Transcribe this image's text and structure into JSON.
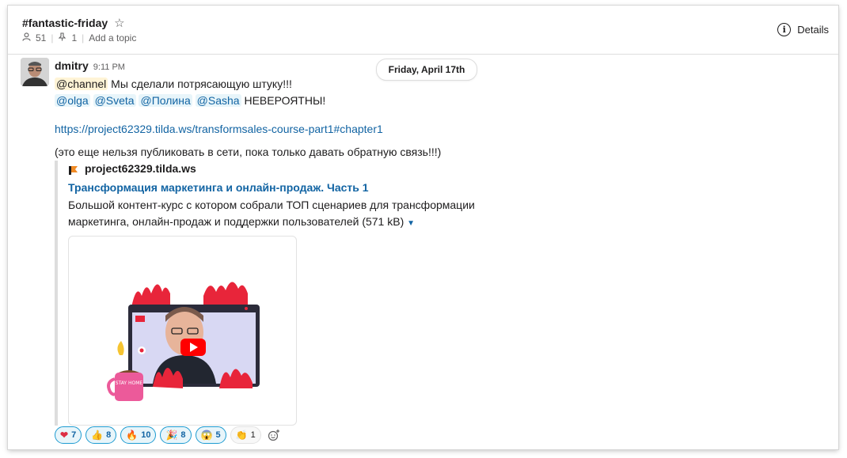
{
  "channel": {
    "name": "#fantastic-friday",
    "members": "51",
    "pinned": "1",
    "topic_placeholder": "Add a topic",
    "details_label": "Details"
  },
  "date_divider": "Friday, April 17th",
  "message": {
    "author": "dmitry",
    "time": "9:11 PM",
    "channel_mention": "@channel",
    "line1_text": " Мы сделали потрясающую штуку!!!",
    "mentions": [
      "@olga",
      "@Sveta",
      "@Полина",
      "@Sasha"
    ],
    "line2_text": " НЕВЕРОЯТНЫ!",
    "url": "https://project62329.tilda.ws/transformsales-course-part1#chapter1",
    "note": "(это еще нельзя публиковать в сети, пока только давать обратную связь!!!)"
  },
  "unfurl": {
    "site": "project62329.tilda.ws",
    "title": "Трансформация маркетинга и онлайн-продаж. Часть 1",
    "desc_line1": "Большой контент-курс с котором собрали ТОП сценариев для трансформации",
    "desc_line2": "маркетинга, онлайн-продаж и поддержки пользователей (571 kB)",
    "mug_text": "STAY HOME"
  },
  "reactions": [
    {
      "emoji": "❤",
      "count": "7"
    },
    {
      "emoji": "👍",
      "count": "8"
    },
    {
      "emoji": "🔥",
      "count": "10"
    },
    {
      "emoji": "🎉",
      "count": "8"
    },
    {
      "emoji": "😱",
      "count": "5"
    },
    {
      "emoji": "👏",
      "count": "1"
    }
  ],
  "colors": {
    "link": "#1264a3",
    "reaction_border": "#1d9bd1",
    "flame": "#e8253a"
  }
}
